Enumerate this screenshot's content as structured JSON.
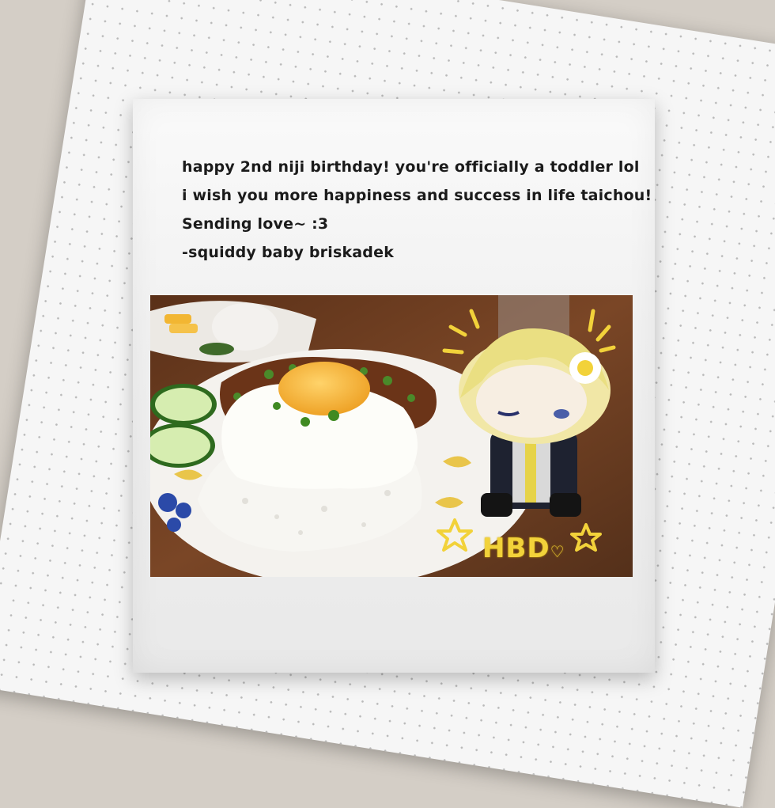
{
  "message": {
    "lines": [
      "happy 2nd niji birthday! you're officially a toddler lol",
      "i wish you more happiness and success in life taichou!",
      "Sending love~ :3",
      "-squiddy baby briskadek"
    ]
  },
  "photo": {
    "sticker_text": "HBD",
    "heart_symbol": "♡",
    "colors": {
      "table": "#6a3f22",
      "plate": "#f4f2ee",
      "yolk": "#f4b63a",
      "doodle": "#f2d23a"
    }
  }
}
